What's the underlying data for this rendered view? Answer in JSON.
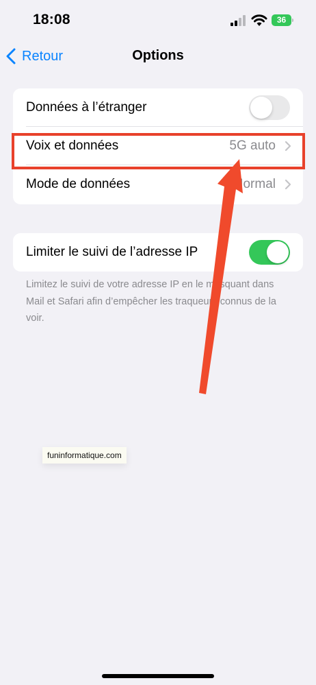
{
  "status_bar": {
    "time": "18:08",
    "battery": "36",
    "signal_icon": "cellular-signal-icon",
    "wifi_icon": "wifi-icon",
    "battery_color": "#34c759"
  },
  "nav": {
    "back_label": "Retour",
    "back_icon": "chevron-left-icon",
    "title": "Options",
    "accent": "#0a84ff"
  },
  "group1": {
    "row1": {
      "label": "Données à l’étranger",
      "toggle": "off"
    },
    "row2": {
      "label": "Voix et données",
      "value": "5G auto"
    },
    "row3": {
      "label": "Mode de données",
      "value": "Normal"
    }
  },
  "group2": {
    "row1": {
      "label": "Limiter le suivi de l’adresse IP",
      "toggle": "on"
    },
    "footnote": "Limitez le suivi de votre adresse IP en le masquant dans Mail et Safari afin d’empêcher les traqueurs connus de la voir."
  },
  "annotation": {
    "color": "#e8412b"
  },
  "watermark": "funinformatique.com"
}
